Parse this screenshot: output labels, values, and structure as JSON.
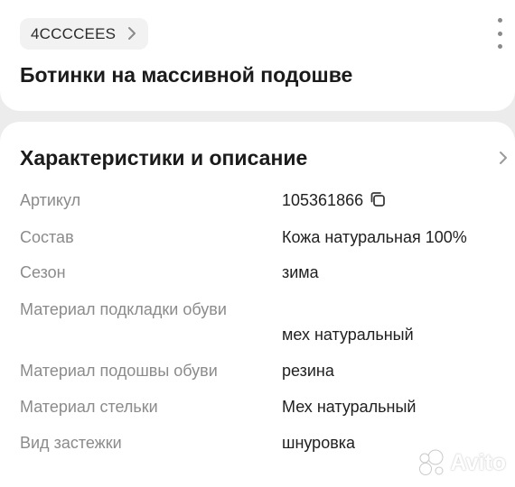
{
  "header": {
    "brand_chip_label": "4CCCCEES",
    "title": "Ботинки на массивной подошве"
  },
  "specs": {
    "section_title": "Характеристики и описание",
    "rows": [
      {
        "key": "Артикул",
        "value": "105361866"
      },
      {
        "key": "Состав",
        "value": "Кожа натуральная 100%"
      },
      {
        "key": "Сезон",
        "value": "зима"
      },
      {
        "key": "Материал подкладки обуви",
        "value": "мех натуральный"
      },
      {
        "key": "Материал подошвы обуви",
        "value": "резина"
      },
      {
        "key": "Материал стельки",
        "value": "Мех натуральный"
      },
      {
        "key": "Вид застежки",
        "value": "шнуровка"
      }
    ]
  },
  "watermark": {
    "text": "Avito"
  },
  "icons": {
    "chip": "chevron-right-icon",
    "menu": "more-vertical-icon",
    "section": "chevron-right-icon",
    "article": "copy-icon",
    "watermark": "avito-logo-icon"
  },
  "colors": {
    "background": "#ececec",
    "card": "#ffffff",
    "chip": "#f2f2f3",
    "label_gray": "#8b8b8b",
    "text": "#1f1f1f"
  }
}
